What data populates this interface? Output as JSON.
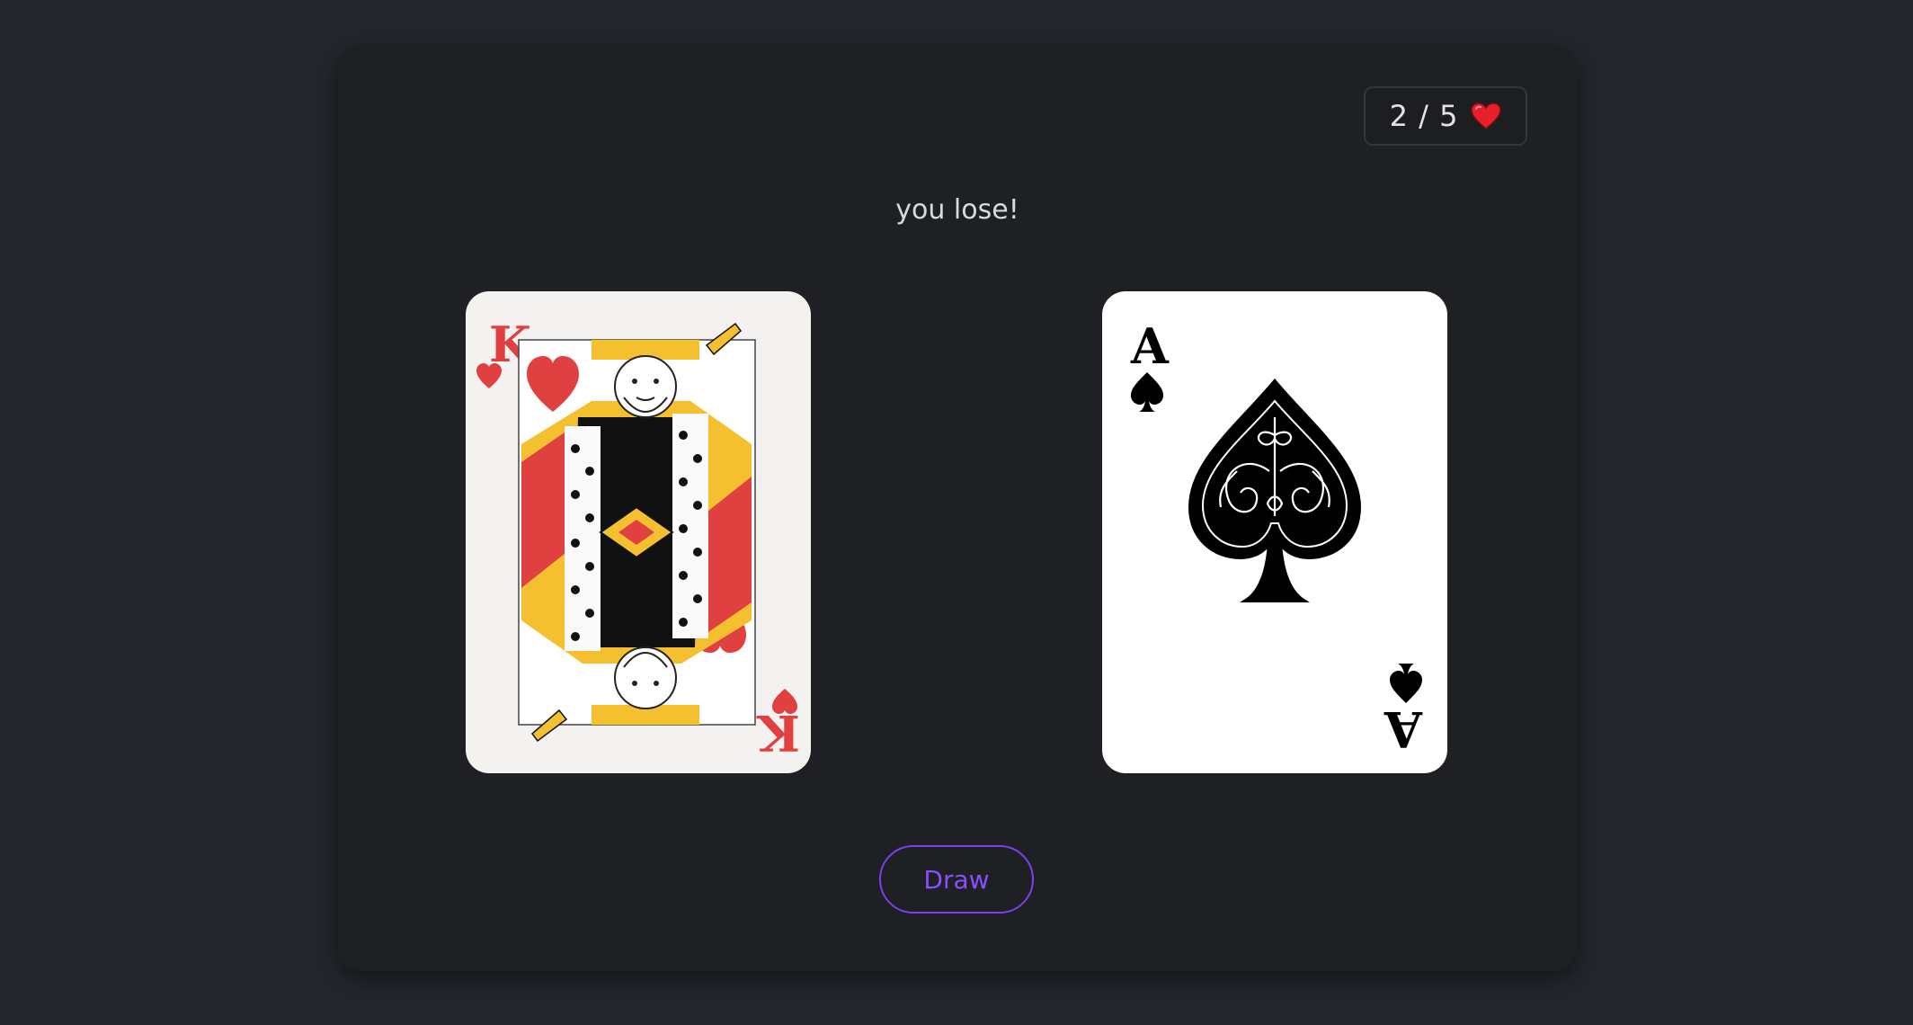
{
  "lives": {
    "current": "2",
    "separator": "/",
    "max": "5",
    "icon": "heart-icon",
    "icon_color": "#e8202a"
  },
  "result": {
    "message": "you lose!"
  },
  "cards": {
    "player": {
      "rank": "K",
      "suit": "hearts",
      "suit_color": "#e0403f"
    },
    "dealer": {
      "rank": "A",
      "suit": "spades",
      "suit_color": "#000000"
    }
  },
  "actions": {
    "draw_label": "Draw"
  },
  "colors": {
    "background": "#23262c",
    "panel": "#1e2024",
    "accent": "#7b3ff0"
  }
}
